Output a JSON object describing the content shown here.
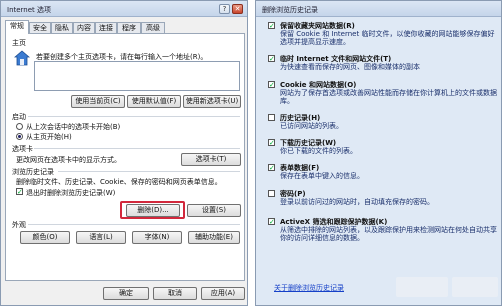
{
  "internet_options": {
    "title": "Internet 选项",
    "help_btn": "?",
    "close_btn": "✕",
    "tabs": [
      "常规",
      "安全",
      "隐私",
      "内容",
      "连接",
      "程序",
      "高级"
    ],
    "home": {
      "section": "主页",
      "hint": "若要创建多个主页选项卡，请在每行输入一个地址(R)。",
      "buttons": [
        "使用当前页(C)",
        "使用默认值(F)",
        "使用新选项卡(U)"
      ]
    },
    "startup": {
      "section": "启动",
      "options": [
        "从上次会话中的选项卡开始(B)",
        "从主页开始(H)"
      ]
    },
    "tabs_section": {
      "section": "选项卡",
      "desc": "更改网页在选项卡中的显示方式。",
      "button": "选项卡(T)"
    },
    "history": {
      "section": "浏览历史记录",
      "desc": "删除临时文件、历史记录、Cookie、保存的密码和网页表单信息。",
      "checkbox": "退出时删除浏览历史记录(W)",
      "delete_btn": "删除(D)...",
      "settings_btn": "设置(S)"
    },
    "appearance": {
      "section": "外观",
      "buttons": [
        "颜色(O)",
        "语言(L)",
        "字体(N)",
        "辅助功能(E)"
      ]
    },
    "footer": [
      "确定",
      "取消",
      "应用(A)"
    ]
  },
  "delete_history": {
    "title": "删除浏览历史记录",
    "items": [
      {
        "checked": true,
        "title": "保留收藏夹网站数据(R)",
        "desc": "保留 Cookie 和 Internet 临时文件，以使你收藏的网站能够保存偏好选项并提高显示速度。"
      },
      {
        "checked": true,
        "title": "临时 Internet 文件和网站文件(T)",
        "desc": "为快速查看而保存的网页、图像和媒体的副本"
      },
      {
        "checked": true,
        "title": "Cookie 和网站数据(O)",
        "desc": "网站为了保存首选项或改善网站性能而存储在你计算机上的文件或数据库。"
      },
      {
        "checked": false,
        "title": "历史记录(H)",
        "desc": "已访问网站的列表。"
      },
      {
        "checked": true,
        "title": "下载历史记录(W)",
        "desc": "你已下载的文件的列表。"
      },
      {
        "checked": true,
        "title": "表单数据(F)",
        "desc": "保存在表单中键入的信息。"
      },
      {
        "checked": false,
        "title": "密码(P)",
        "desc": "登录以前访问过的网站时，自动填充保存的密码。"
      },
      {
        "checked": true,
        "title": "ActiveX 筛选和跟踪保护数据(K)",
        "desc": "从筛选中排除的网站列表，以及跟踪保护用来检测网站在何处自动共享你的访问详细信息的数据。"
      }
    ],
    "link": "关于删除浏览历史记录",
    "check_mark": "✓",
    "colors": {
      "accent": "#1a2f6b",
      "link": "#1540c8",
      "highlight": "#d2283c"
    }
  }
}
